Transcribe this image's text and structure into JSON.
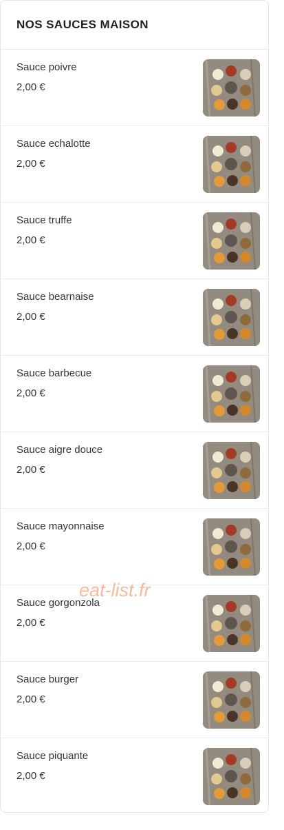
{
  "section": {
    "title": "NOS SAUCES MAISON"
  },
  "items": [
    {
      "name": "Sauce poivre",
      "price": "2,00 €"
    },
    {
      "name": "Sauce echalotte",
      "price": "2,00 €"
    },
    {
      "name": "Sauce truffe",
      "price": "2,00 €"
    },
    {
      "name": "Sauce bearnaise",
      "price": "2,00 €"
    },
    {
      "name": "Sauce barbecue",
      "price": "2,00 €"
    },
    {
      "name": "Sauce aigre douce",
      "price": "2,00 €"
    },
    {
      "name": "Sauce mayonnaise",
      "price": "2,00 €"
    },
    {
      "name": "Sauce gorgonzola",
      "price": "2,00 €"
    },
    {
      "name": "Sauce burger",
      "price": "2,00 €"
    },
    {
      "name": "Sauce piquante",
      "price": "2,00 €"
    }
  ],
  "watermark": "eat-list.fr"
}
